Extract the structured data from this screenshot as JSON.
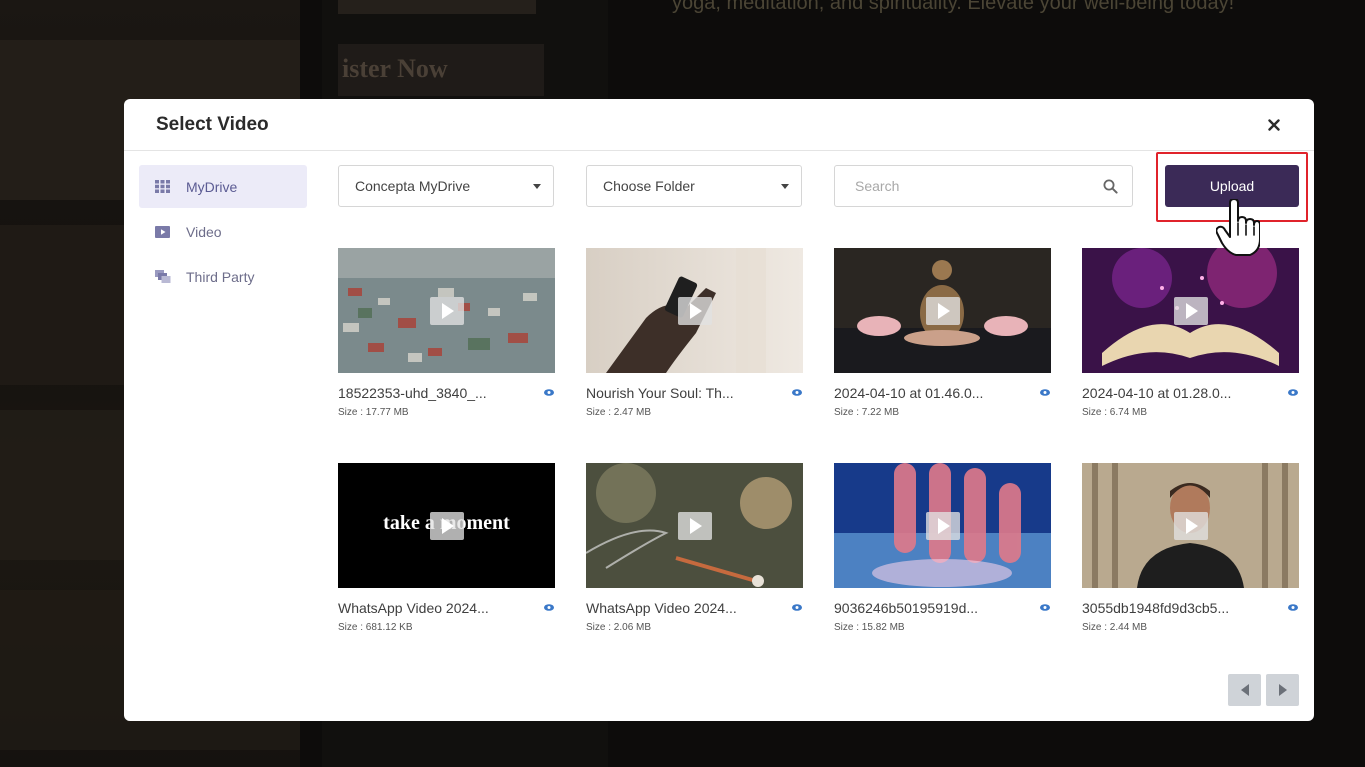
{
  "background": {
    "register_text": "ister Now",
    "tagline_text": "yoga, meditation, and spirituality. Elevate your well-being today!"
  },
  "modal": {
    "title": "Select Video",
    "close_icon": "close-icon"
  },
  "sidebar": {
    "items": [
      {
        "label": "MyDrive",
        "icon": "grid-icon",
        "active": true
      },
      {
        "label": "Video",
        "icon": "video-icon",
        "active": false
      },
      {
        "label": "Third Party",
        "icon": "third-party-icon",
        "active": false
      }
    ]
  },
  "toolbar": {
    "drive_select": "Concepta MyDrive",
    "folder_select": "Choose Folder",
    "search_placeholder": "Search",
    "search_value": "",
    "upload_label": "Upload"
  },
  "videos": [
    {
      "name": "18522353-uhd_3840_...",
      "size": "Size : 17.77 MB"
    },
    {
      "name": "Nourish Your Soul: Th...",
      "size": "Size : 2.47 MB"
    },
    {
      "name": "2024-04-10 at 01.46.0...",
      "size": "Size : 7.22 MB"
    },
    {
      "name": "2024-04-10 at 01.28.0...",
      "size": "Size : 6.74 MB"
    },
    {
      "name": "WhatsApp Video 2024...",
      "size": "Size : 681.12 KB",
      "caption": "take a moment"
    },
    {
      "name": "WhatsApp Video 2024...",
      "size": "Size : 2.06 MB"
    },
    {
      "name": "9036246b50195919d...",
      "size": "Size : 15.82 MB"
    },
    {
      "name": "3055db1948fd9d3cb5...",
      "size": "Size : 2.44 MB"
    }
  ],
  "colors": {
    "upload_button": "#3b2a57",
    "highlight_border": "#e0232b",
    "sidebar_active_bg": "#ecebf8",
    "eye_icon": "#3a78c8"
  }
}
